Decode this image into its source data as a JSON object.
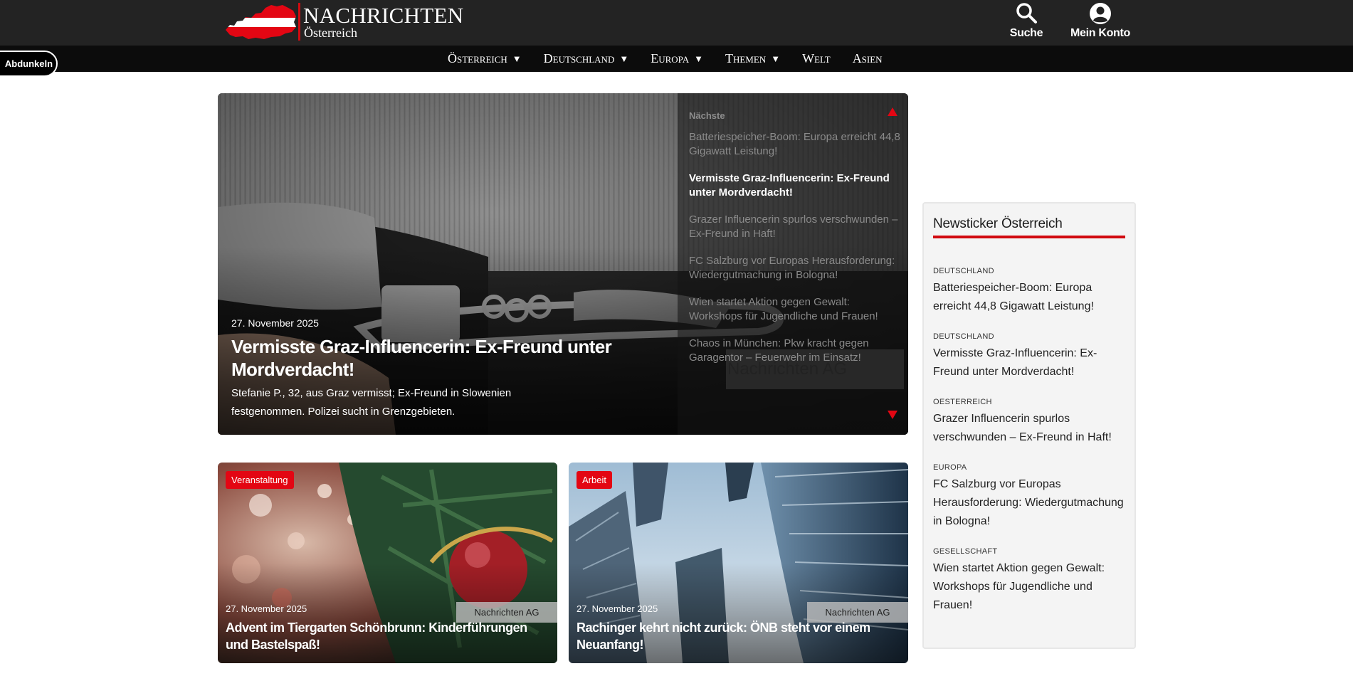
{
  "header": {
    "logo_title": "NACHRICHTEN",
    "logo_subtitle": "Österreich",
    "search_label": "Suche",
    "account_label": "Mein Konto",
    "dark_mode_label": "Abdunkeln"
  },
  "nav": {
    "items": [
      {
        "label": "Österreich",
        "dropdown": true
      },
      {
        "label": "Deutschland",
        "dropdown": true
      },
      {
        "label": "Europa",
        "dropdown": true
      },
      {
        "label": "Themen",
        "dropdown": true
      },
      {
        "label": "Welt",
        "dropdown": false
      },
      {
        "label": "Asien",
        "dropdown": false
      }
    ],
    "caret": "▼"
  },
  "hero": {
    "date": "27. November 2025",
    "title": "Vermisste Graz-Influencerin: Ex-Freund unter Mordverdacht!",
    "description": "Stefanie P., 32, aus Graz vermisst; Ex-Freund in Slowenien festgenommen. Polizei sucht in Grenzgebieten.",
    "next_label": "Nächste",
    "watermark": "Nachrichten AG",
    "next_items": [
      {
        "title": "Batteriespeicher-Boom: Europa erreicht 44,8 Gigawatt Leistung!",
        "active": false
      },
      {
        "title": "Vermisste Graz-Influencerin: Ex-Freund unter Mordverdacht!",
        "active": true
      },
      {
        "title": "Grazer Influencerin spurlos verschwunden – Ex-Freund in Haft!",
        "active": false
      },
      {
        "title": "FC Salzburg vor Europas Herausforderung: Wiedergutmachung in Bologna!",
        "active": false
      },
      {
        "title": "Wien startet Aktion gegen Gewalt: Workshops für Jugendliche und Frauen!",
        "active": false
      },
      {
        "title": "Chaos in München: Pkw kracht gegen Garagentor – Feuerwehr im Einsatz!",
        "active": false
      }
    ]
  },
  "cards": [
    {
      "badge": "Veranstaltung",
      "source": "Nachrichten AG",
      "date": "27. November 2025",
      "title": "Advent im Tiergarten Schönbrunn: Kinderführungen und Bastelspaß!"
    },
    {
      "badge": "Arbeit",
      "source": "Nachrichten AG",
      "date": "27. November 2025",
      "title": "Rachinger kehrt nicht zurück: ÖNB steht vor einem Neuanfang!"
    }
  ],
  "ticker": {
    "title": "Newsticker Österreich",
    "items": [
      {
        "category": "Deutschland",
        "title": "Batteriespeicher-Boom: Europa erreicht 44,8 Gigawatt Leistung!"
      },
      {
        "category": "Deutschland",
        "title": "Vermisste Graz-Influencerin: Ex-Freund unter Mordverdacht!"
      },
      {
        "category": "Oesterreich",
        "title": "Grazer Influencerin spurlos verschwunden – Ex-Freund in Haft!"
      },
      {
        "category": "Europa",
        "title": "FC Salzburg vor Europas Herausforderung: Wiedergutmachung in Bologna!"
      },
      {
        "category": "Gesellschaft",
        "title": "Wien startet Aktion gegen Gewalt: Workshops für Jugendliche und Frauen!"
      }
    ]
  },
  "colors": {
    "brand_red": "#e30613",
    "topbar": "#232323",
    "navbar": "#0c0c0c"
  },
  "icons": {
    "search": "search-icon",
    "account": "user-circle-icon",
    "logo": "austria-flag-map-icon"
  }
}
